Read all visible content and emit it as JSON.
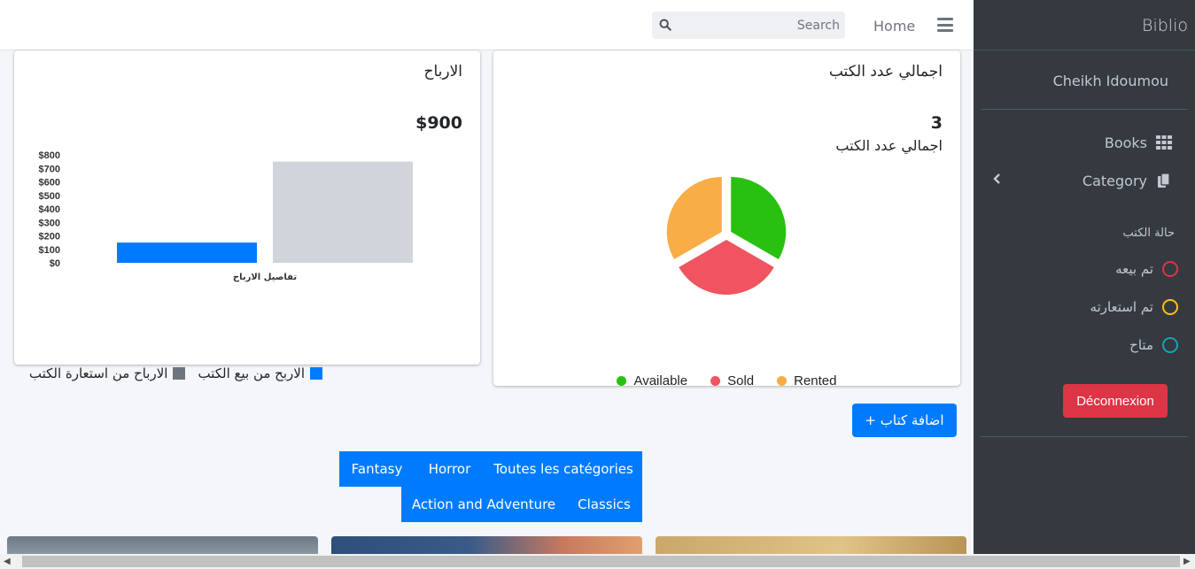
{
  "navbar": {
    "home_label": "Home",
    "search_placeholder": "Search"
  },
  "sidebar": {
    "brand": "Biblio",
    "user_name": "Cheikh Idoumou",
    "items": [
      {
        "label": "Books",
        "icon": "grid-icon"
      },
      {
        "label": "Category",
        "icon": "copy-icon"
      }
    ],
    "status_header": "حالة الكتب",
    "statuses": [
      {
        "label": "تم بيعه",
        "color": "#dc3545"
      },
      {
        "label": "تم استعارته",
        "color": "#ffc107"
      },
      {
        "label": "متاح",
        "color": "#17a2b8"
      }
    ],
    "logout_label": "Déconnexion"
  },
  "profit_card": {
    "title": "الارباح",
    "total": "$900",
    "legend": [
      {
        "label": "الاربح من بيع الكتب",
        "color": "#007bff"
      },
      {
        "label": "الارباح من استعارة الكتب",
        "color": "#6c757d"
      }
    ]
  },
  "books_card": {
    "title": "اجمالي عدد الكتب",
    "count": "3",
    "count_label": "اجمالي عدد الكتب",
    "legend": [
      {
        "label": "Available",
        "color": "#28c10f"
      },
      {
        "label": "Sold",
        "color": "#f05461"
      },
      {
        "label": "Rented",
        "color": "#f8ad47"
      }
    ]
  },
  "add_book_label": "+ اضافة كتاب",
  "categories": {
    "row1": [
      "Fantasy",
      "Horror",
      "Toutes les catégories"
    ],
    "row2": [
      "Action and Adventure",
      "Classics"
    ]
  },
  "chart_data": [
    {
      "type": "bar",
      "categories": [
        "تفاصيل الارباح"
      ],
      "series": [
        {
          "name": "الاربح من بيع الكتب",
          "values": [
            150
          ],
          "color": "#007bff"
        },
        {
          "name": "الارباح من استعارة الكتب",
          "values": [
            750
          ],
          "color": "#d0d4db"
        }
      ],
      "yticks": [
        "$0",
        "$100",
        "$200",
        "$300",
        "$400",
        "$500",
        "$600",
        "$700",
        "$800"
      ],
      "ylim": [
        0,
        800
      ],
      "xlabel": "تفاصيل الارباح"
    },
    {
      "type": "pie",
      "labels": [
        "Available",
        "Sold",
        "Rented"
      ],
      "values": [
        1,
        1,
        1
      ],
      "colors": [
        "#28c10f",
        "#f05461",
        "#f8ad47"
      ]
    }
  ]
}
